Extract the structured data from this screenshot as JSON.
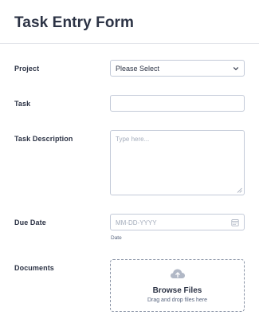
{
  "form": {
    "title": "Task Entry Form",
    "fields": {
      "project": {
        "label": "Project",
        "selected": "Please Select"
      },
      "task": {
        "label": "Task",
        "value": ""
      },
      "task_description": {
        "label": "Task Description",
        "placeholder": "Type here..."
      },
      "due_date": {
        "label": "Due Date",
        "placeholder": "MM-DD-YYYY",
        "sublabel": "Date"
      },
      "documents": {
        "label": "Documents",
        "browse_label": "Browse Files",
        "hint": "Drag and drop files here"
      }
    }
  },
  "icons": {
    "select_arrow": "chevron-down-icon",
    "calendar": "calendar-icon",
    "upload": "cloud-upload-icon",
    "resize": "resize-grip-icon"
  },
  "colors": {
    "text": "#2c3345",
    "border": "#c3cad8",
    "placeholder": "#a5adbc",
    "icon": "#b1b8c6"
  }
}
